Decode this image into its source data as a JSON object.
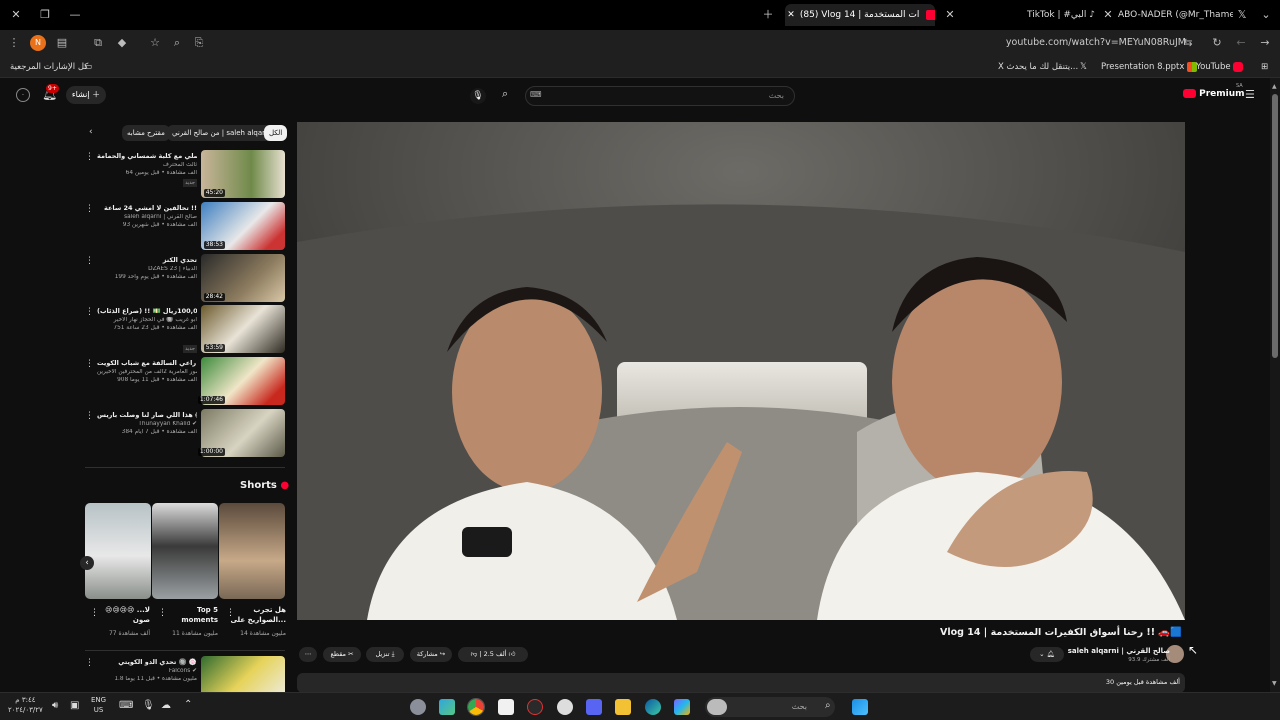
{
  "browser": {
    "tabs": [
      {
        "label": "ABO-NADER (@Mr_Thamer10"
      },
      {
        "label": "TikTok | #البي"
      },
      {
        "label": "(85) Vlog 14 | ات المستخدمة",
        "active": true
      }
    ],
    "url": "youtube.com/watch?v=MEYuN08RuJM",
    "bookmarks": {
      "all_label": "كل الإشارات المرجعية",
      "items": [
        "YouTube",
        "Presentation 8.pptx",
        "يتنقل لك ما يحدث..."
      ],
      "x_label": "X"
    }
  },
  "yt_header": {
    "premium_label": "Premium",
    "premium_region": "SA",
    "search_placeholder": "بحث",
    "create_label": "إنشاء",
    "notif_count": "9+"
  },
  "chips": [
    "الكل",
    "من صالح القرني | saleh alqarni",
    "مقترح مشابه"
  ],
  "recommendations": [
    {
      "title": "اسلي مع كلبة شمساني والحمامة 👀",
      "channel": "ثالث المحترف",
      "meta": "64 ألف مشاهدة • قبل يومين",
      "duration": "45:20",
      "badge": "جديد"
    },
    {
      "title": "تحالفين لا امشي 24 ساعة !!",
      "channel": "saleh alqarni | صالح القرني",
      "meta": "93 ألف مشاهدة • قبل شهرين",
      "duration": "38:53",
      "badge": "جديد"
    },
    {
      "title": "تحدي الكنز",
      "channel": "DZAES 23 | الدبياء",
      "meta": "199 ألف مشاهدة • قبل يوم واحد",
      "duration": "28:42",
      "badge": "جديد"
    },
    {
      "title": "اخر شخص يطلع من المكان يفوز ب100,000ريال 💵 !! (صراع الذئاب) 😱...",
      "channel": "ابو غريب 🔘 في الحجاز نهار الأخير",
      "meta": "751 ألف مشاهدة • قبل 23 ساعة",
      "duration": "53:59",
      "badge": "جديد"
    },
    {
      "title": "من راعي السالفة مع شباب الكويت",
      "channel": "منصور العامرية 2ألف من المحترفين الأخيرين",
      "meta": "908 ألف مشاهدة • قبل 11 يوماً",
      "duration": "1:07:46",
      "badge": ""
    },
    {
      "title": "هذا اللي صار لنا وصلت باريس 😱",
      "channel": "Thunayyan Khalid ✔",
      "meta": "384 ألف مشاهدة • قبل 7 أيام",
      "duration": "1:00:00",
      "badge": ""
    }
  ],
  "shorts": {
    "heading": "Shorts",
    "items": [
      {
        "title": "هل تجرب الصواريخ على...",
        "views": "14 مليون مشاهدة"
      },
      {
        "title": "Top 5 moments",
        "views": "11 مليون مشاهدة"
      },
      {
        "title": "😢😢😢😢 ...لا صون",
        "views": "77 ألف مشاهدة"
      }
    ]
  },
  "next_reco": {
    "title": "تحدي الدو الكويتي 🔘 🍥",
    "channel": "Falcons ✔",
    "meta": "1.8 مليون مشاهدة • قبل 11 يوماً"
  },
  "video": {
    "title": "Vlog 14 | رحنا أسواق الكفيرات المستخدمة !! 🚗🟦",
    "channel": "saleh alqarni | صالح القرني",
    "subs": "93.9 ألف مشترك",
    "likes": "2.5 ألف",
    "share": "مشاركة",
    "download": "تنزيل",
    "clip": "مقطع",
    "description": "30 ألف مشاهدة قبل يومين"
  },
  "taskbar": {
    "search_placeholder": "بحث",
    "lang": "ENG",
    "lang_region": "US",
    "time": "٣:٤٤ م",
    "date": "٢٠٢٤/٠٣/٢٧"
  }
}
